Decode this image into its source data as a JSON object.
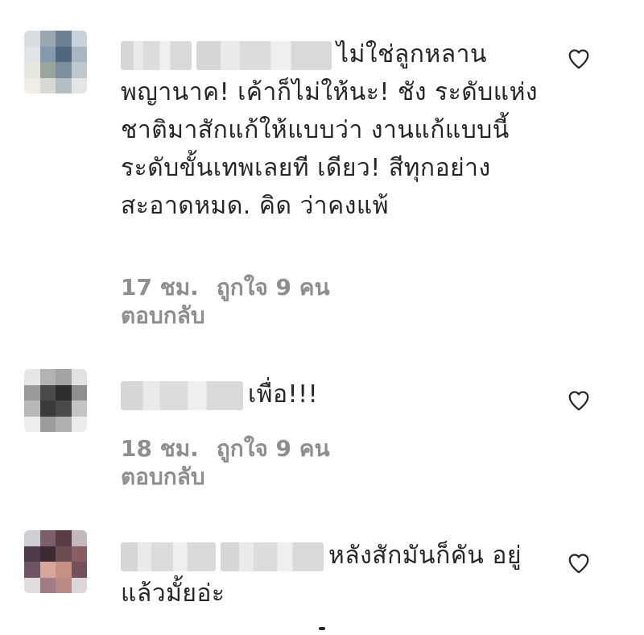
{
  "comments": [
    {
      "text": "ไม่ใช่ลูกหลาน พญานาค! เค้าก็ไม่ให้นะ! ชัง ระดับแห่งชาติมาสักแก้ให้แบบว่า งานแก้แบบนี้ระดับขั้นเทพเลยที เดียว! สีทุกอย่างสะอาดหมด. คิด ว่าคงแพ้",
      "time": "17 ชม.",
      "likes": "ถูกใจ 9 คน",
      "reply": "ตอบกลับ"
    },
    {
      "text": "เพื่อ!!!",
      "time": "18 ชม.",
      "likes": "ถูกใจ 9 คน",
      "reply": "ตอบกลับ"
    },
    {
      "text": "หลังสักมันก็คัน อยู่แล้วมั้ยอ่ะ"
    }
  ],
  "icons": {
    "like": "heart-outline-icon"
  },
  "colors": {
    "text": "#262626",
    "meta": "#8e8e8e"
  }
}
